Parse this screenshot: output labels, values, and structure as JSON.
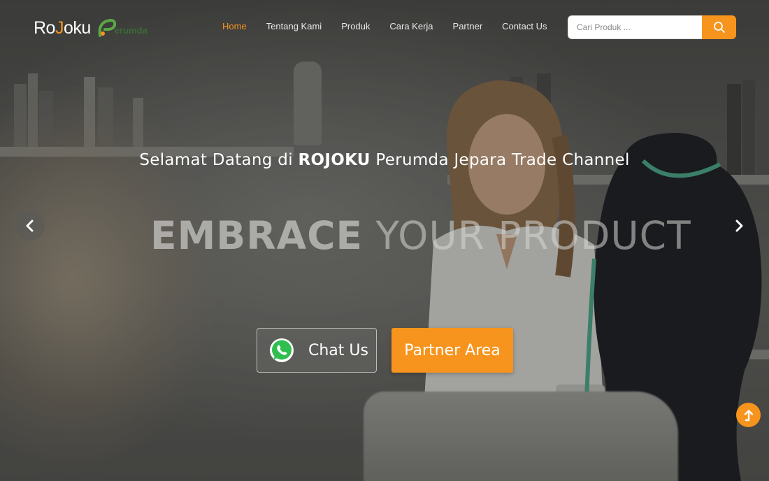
{
  "brand": {
    "logo_text_a": "Ro",
    "logo_text_j": "J",
    "logo_text_b": "oku",
    "partner_logo_text": "erumda",
    "accent_color": "#f7941d",
    "partner_logo_color": "#3a6b35"
  },
  "nav": {
    "items": [
      {
        "label": "Home",
        "active": true
      },
      {
        "label": "Tentang Kami",
        "active": false
      },
      {
        "label": "Produk",
        "active": false
      },
      {
        "label": "Cara Kerja",
        "active": false
      },
      {
        "label": "Partner",
        "active": false
      },
      {
        "label": "Contact Us",
        "active": false
      }
    ]
  },
  "search": {
    "placeholder": "Cari Produk ...",
    "icon": "search-icon"
  },
  "hero": {
    "title_prefix": "Selamat Datang di ",
    "title_brand": "ROJOKU",
    "title_suffix": " Perumda Jepara Trade Channel",
    "slogan_bold": "EMBRACE",
    "slogan_light": " YOUR PRODUCT",
    "prev_icon": "chevron-left-icon",
    "next_icon": "chevron-right-icon"
  },
  "cta": {
    "chat_label": "Chat Us",
    "chat_icon": "whatsapp-icon",
    "partner_label": "Partner Area"
  },
  "back_to_top": {
    "icon": "arrow-up-icon"
  }
}
